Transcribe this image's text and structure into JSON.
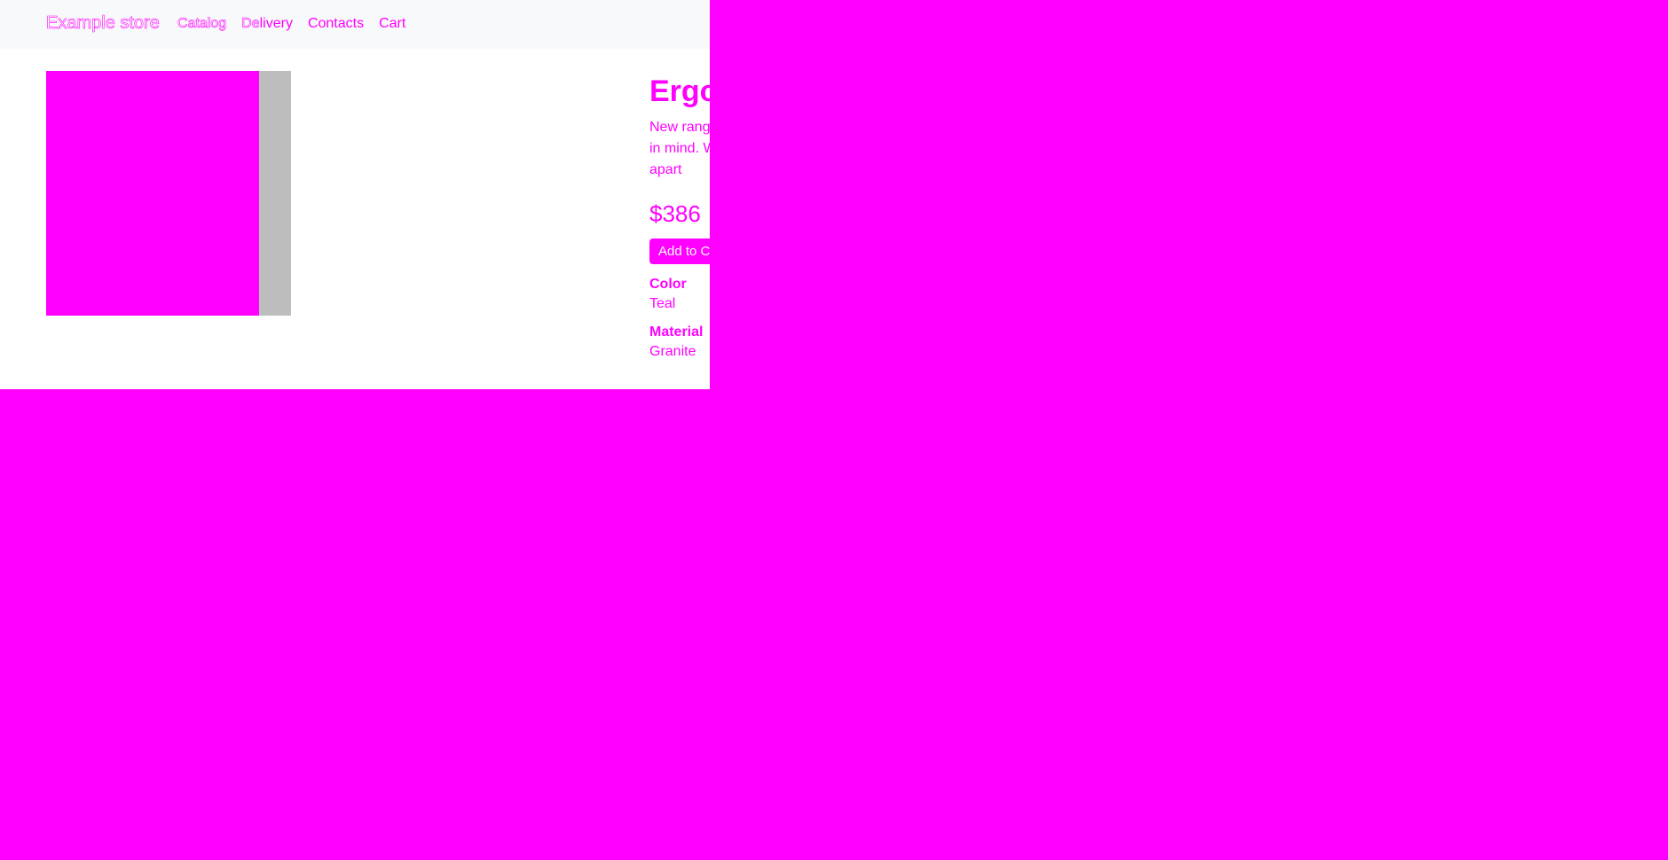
{
  "store": {
    "brand": "Example store",
    "nav": [
      "Catalog",
      "Delivery",
      "Contacts",
      "Cart"
    ]
  },
  "product": {
    "name": "Ergonomic Gloves",
    "description": "New range of formal shirts are designed keeping you in mind. With fits and styling that will make you stand apart",
    "price": "$386",
    "add_to_cart": "Add to Cart",
    "specs": [
      {
        "label": "Color",
        "value": "Teal"
      },
      {
        "label": "Material",
        "value": "Granite"
      }
    ]
  },
  "colors": {
    "accent": "#ff00ff",
    "navbar_bg": "#f8f9fa",
    "strip_gray": "#bdbdbd"
  }
}
